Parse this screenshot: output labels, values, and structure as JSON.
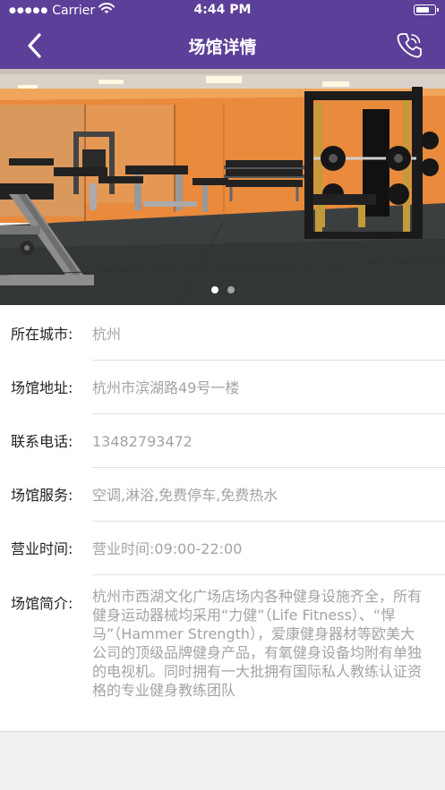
{
  "status_bar": {
    "carrier": "Carrier",
    "time": "4:44 PM",
    "battery_level": 0.8
  },
  "nav": {
    "title": "场馆详情",
    "back_icon": "chevron-left-icon",
    "phone_icon": "phone-icon"
  },
  "banner": {
    "image": "gym-interior-photo",
    "slide_count": 2,
    "active_slide": 0
  },
  "details": [
    {
      "label": "所在城市:",
      "value": "杭州"
    },
    {
      "label": "场馆地址:",
      "value": "杭州市滨湖路49号一楼"
    },
    {
      "label": "联系电话:",
      "value": "13482793472"
    },
    {
      "label": "场馆服务:",
      "value": "空调,淋浴,免费停车,免费热水"
    },
    {
      "label": "营业时间:",
      "value": "营业时间:09:00-22:00"
    },
    {
      "label": "场馆简介:",
      "value": "杭州市西湖文化广场店场内各种健身设施齐全，所有健身运动器械均采用“力健”（Life Fitness）、“悍马”（Hammer Strength），爱康健身器材等欧美大公司的顶级品牌健身产品，有氧健身设备均附有单独的电视机。同时拥有一大批拥有国际私人教练认证资格的专业健身教练团队"
    }
  ],
  "colors": {
    "header": "#5b3f98",
    "label": "#222222",
    "value": "#a3a3a3",
    "wall": "#e98a3c"
  }
}
